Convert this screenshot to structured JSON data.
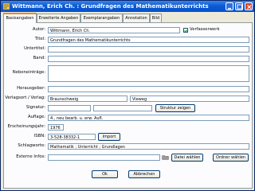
{
  "window": {
    "title": "Wittmann, Erich Ch. : Grundfragen des Mathematikunterrichts"
  },
  "tabs": [
    {
      "label": "Basisangaben",
      "active": true
    },
    {
      "label": "Erweiterte Angaben",
      "active": false
    },
    {
      "label": "Exemplarangaben",
      "active": false
    },
    {
      "label": "Annotation",
      "active": false
    },
    {
      "label": "Bild",
      "active": false
    }
  ],
  "form": {
    "autor": {
      "label": "Autor:",
      "value": "Wittmann, Erich Ch."
    },
    "verfasserwerk": {
      "label": "Verfasserwerk",
      "checked": true
    },
    "titel": {
      "label": "Titel:",
      "value": "Grundfragen des Mathematikunterrichts"
    },
    "untertitel": {
      "label": "Untertitel:",
      "value": ""
    },
    "band": {
      "label": "Band:",
      "value": ""
    },
    "nebeneintraege": {
      "label": "Nebeneinträge:",
      "value": ""
    },
    "herausgeber": {
      "label": "Herausgeber:",
      "value": ""
    },
    "verlagsort": {
      "label": "Verlagsort / Verlag:",
      "ort": "Braunschweig",
      "verlag": "Vieweg"
    },
    "signatur": {
      "label": "Signatur:",
      "value1": "",
      "value2": "",
      "button": "Struktur zeigen"
    },
    "auflage": {
      "label": "Auflage:",
      "value": "4., neu bearb. u. erw. Aufl."
    },
    "erscheinungsjahr": {
      "label": "Erscheinungsjahr:",
      "value": "1976"
    },
    "isbn": {
      "label": "ISBN:",
      "value": "3-528-38332-1",
      "button": "Import"
    },
    "schlagworte": {
      "label": "Schlagworte:",
      "value": "Mathematik ; Unterricht ; Grundlagen"
    },
    "externe": {
      "label": "Externe Infos:",
      "value": "",
      "datei_button": "Datei wählen",
      "ordner_button": "Ordner wählen"
    }
  },
  "footer": {
    "ok": "Ok",
    "abbrechen": "Abbrechen"
  }
}
